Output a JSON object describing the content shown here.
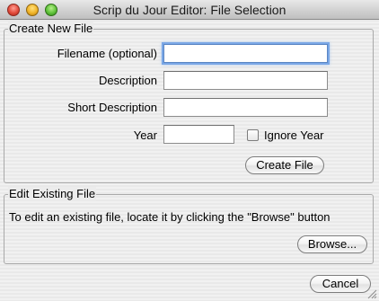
{
  "window": {
    "title": "Scrip du Jour Editor: File Selection"
  },
  "create_section": {
    "legend": "Create New File",
    "filename_label": "Filename (optional)",
    "filename_value": "",
    "description_label": "Description",
    "description_value": "",
    "short_description_label": "Short Description",
    "short_description_value": "",
    "year_label": "Year",
    "year_value": "",
    "ignore_year_label": "Ignore Year",
    "ignore_year_checked": false,
    "create_button": "Create File"
  },
  "edit_section": {
    "legend": "Edit Existing File",
    "instructions": "To edit an existing file, locate it by clicking the \"Browse\" button",
    "browse_button": "Browse..."
  },
  "footer": {
    "cancel_button": "Cancel"
  },
  "colors": {
    "focus_ring": "#7aa7e6",
    "window_background": "#ececec"
  }
}
